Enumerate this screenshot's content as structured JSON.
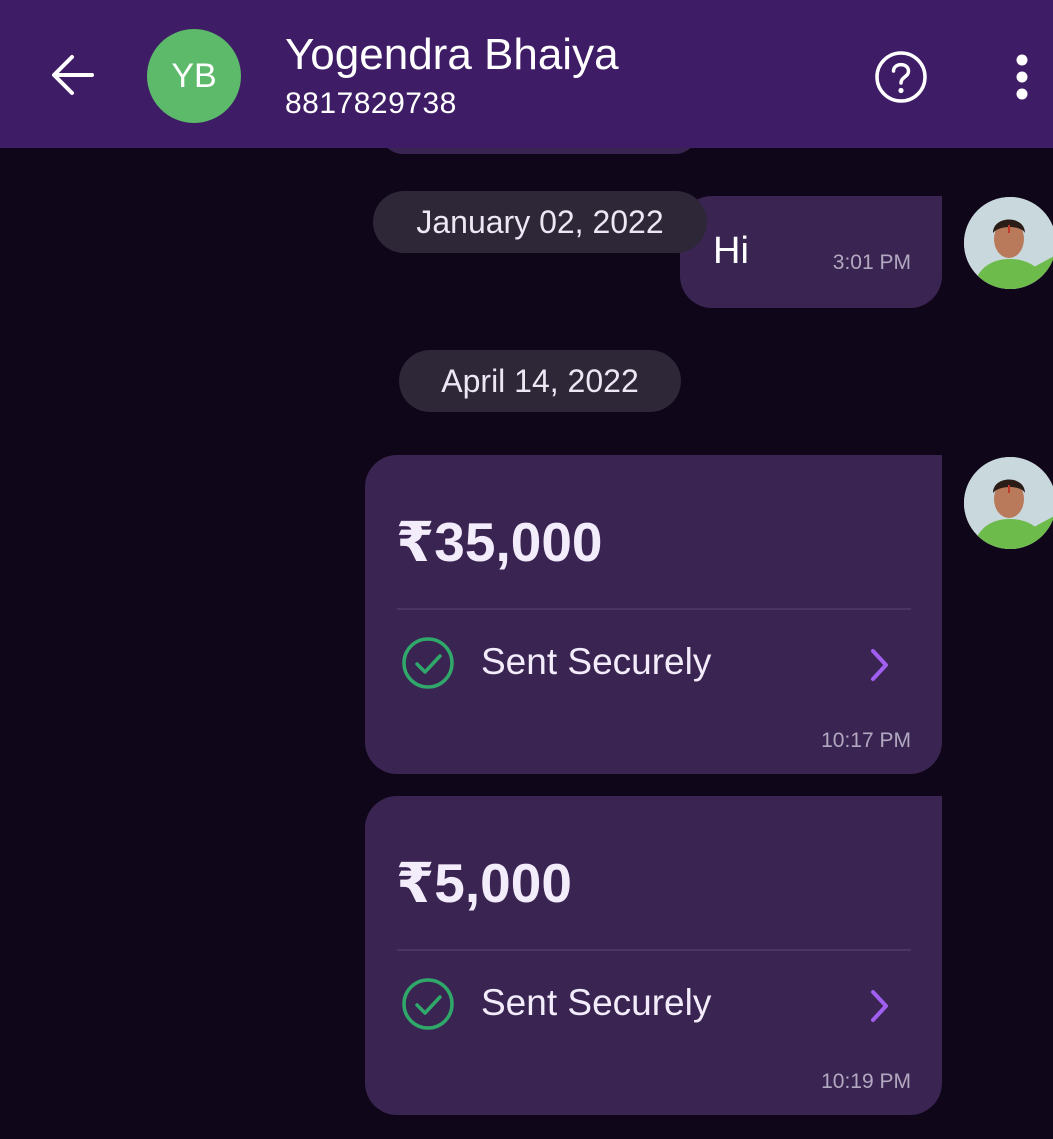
{
  "header": {
    "contact_initials": "YB",
    "contact_name": "Yogendra Bhaiya",
    "contact_phone": "8817829738",
    "back_icon": "arrow-left-icon",
    "help_icon": "question-circle-icon",
    "menu_icon": "more-vertical-icon"
  },
  "messages": {
    "date_1": "January 02, 2022",
    "hi_text": "Hi",
    "hi_time": "3:01 PM",
    "date_2": "April 14, 2022",
    "payment_1": {
      "amount": "₹35,000",
      "status": "Sent Securely",
      "time": "10:17 PM"
    },
    "payment_2": {
      "amount": "₹5,000",
      "status": "Sent Securely",
      "time": "10:19 PM"
    }
  },
  "colors": {
    "header_bg": "#3f1c66",
    "chat_bg": "#0f0619",
    "bubble_bg": "#3a2452",
    "success_green": "#2fa86a",
    "accent_purple": "#a05ff0"
  }
}
